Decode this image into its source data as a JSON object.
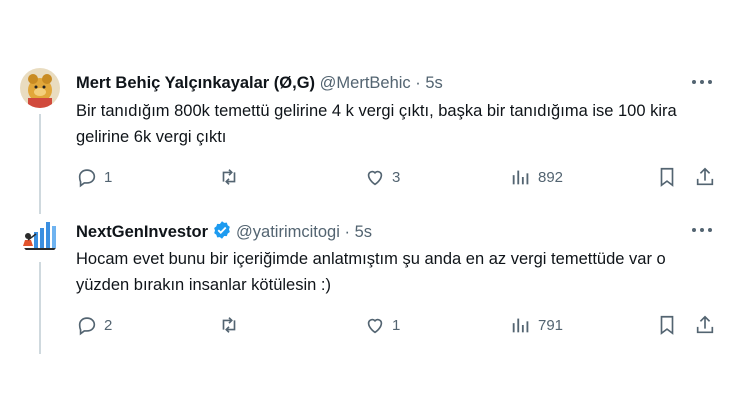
{
  "tweets": [
    {
      "author_name": "Mert Behiç Yalçınkayalar (Ø,G)",
      "handle": "@MertBehic",
      "separator": "·",
      "time": "5s",
      "text": "Bir tanıdığım 800k temettü gelirine 4 k vergi çıktı, başka bir tanıdığıma ise 100 kira gelirine 6k vergi çıktı",
      "verified": false,
      "replies": "1",
      "retweets": "",
      "likes": "3",
      "views": "892"
    },
    {
      "author_name": "NextGenInvestor",
      "handle": "@yatirimcitogi",
      "separator": "·",
      "time": "5s",
      "text": "Hocam evet bunu bir içeriğimde anlatmıştım şu anda en az vergi temettüde var o yüzden bırakın insanlar kötülesin :)",
      "verified": true,
      "replies": "2",
      "retweets": "",
      "likes": "1",
      "views": "791"
    }
  ],
  "colors": {
    "text": "#0f1419",
    "muted": "#536471",
    "verified_blue": "#1d9bf0",
    "thread_line": "#cfd9de"
  },
  "icons": [
    "reply-icon",
    "retweet-icon",
    "like-icon",
    "views-icon",
    "bookmark-icon",
    "share-icon",
    "more-icon",
    "verified-icon"
  ]
}
